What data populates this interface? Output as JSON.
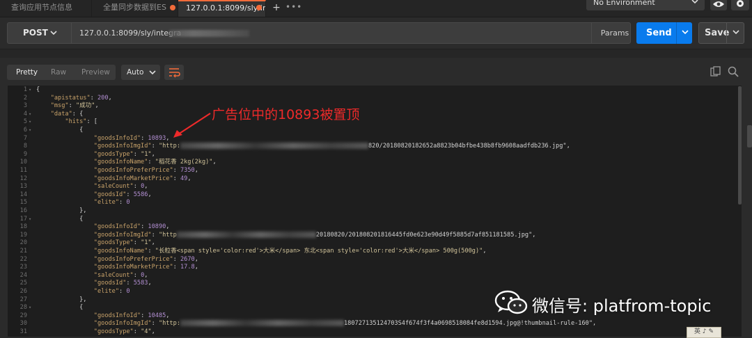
{
  "tabs": [
    {
      "label": "查询应用节点信息",
      "active": false,
      "unsaved": false
    },
    {
      "label": "全量同步数据到ES",
      "active": false,
      "unsaved": true
    },
    {
      "label": "127.0.0.1:8099/sly/in",
      "active": true,
      "unsaved": true
    }
  ],
  "tab_actions": {
    "add": "+",
    "more": "•••"
  },
  "environment": {
    "label": "No Environment"
  },
  "request": {
    "method": "POST",
    "url": "127.0.0.1:8099/sly/integra",
    "params_label": "Params",
    "send_label": "Send",
    "save_label": "Save"
  },
  "response_toolbar": {
    "formats": [
      "Pretty",
      "Raw",
      "Preview"
    ],
    "selected_format": "Pretty",
    "language": "Auto"
  },
  "colors": {
    "accent": "#f26b3a",
    "send": "#097bed",
    "annotation": "#ee2a2a"
  },
  "code_lines": [
    {
      "n": "1",
      "f": "▾",
      "t": "{"
    },
    {
      "n": "2",
      "f": "",
      "t": "    \"apistatus\": 200,"
    },
    {
      "n": "3",
      "f": "",
      "t": "    \"msg\": \"成功\","
    },
    {
      "n": "4",
      "f": "▾",
      "t": "    \"data\": {"
    },
    {
      "n": "5",
      "f": "▾",
      "t": "        \"hits\": ["
    },
    {
      "n": "6",
      "f": "▾",
      "t": "            {"
    },
    {
      "n": "7",
      "f": "",
      "t": "                \"goodsInfoId\": 10893,"
    },
    {
      "n": "8",
      "f": "",
      "t": "                \"goodsInfoImgId\": \"http:",
      "tail": "820/20180820182652a8823b04bfbe438b8fb9608aadfdb236.jpg\",",
      "blur": 270
    },
    {
      "n": "9",
      "f": "",
      "t": "                \"goodsType\": \"1\","
    },
    {
      "n": "10",
      "f": "",
      "t": "                \"goodsInfoName\": \"稻花香 2kg(2kg)\","
    },
    {
      "n": "11",
      "f": "",
      "t": "                \"goodsInfoPreferPrice\": 7350,"
    },
    {
      "n": "12",
      "f": "",
      "t": "                \"goodsInfoMarketPrice\": 49,"
    },
    {
      "n": "13",
      "f": "",
      "t": "                \"saleCount\": 0,"
    },
    {
      "n": "14",
      "f": "",
      "t": "                \"goodsId\": 5586,"
    },
    {
      "n": "15",
      "f": "",
      "t": "                \"elite\": 0"
    },
    {
      "n": "16",
      "f": "",
      "t": "            },"
    },
    {
      "n": "17",
      "f": "▾",
      "t": "            {"
    },
    {
      "n": "18",
      "f": "",
      "t": "                \"goodsInfoId\": 10890,"
    },
    {
      "n": "19",
      "f": "",
      "t": "                \"goodsInfoImgId\": \"http",
      "tail": "20180820/201808201816445fd0e623e90d49f5885d7af851181585.jpg\",",
      "blur": 200
    },
    {
      "n": "20",
      "f": "",
      "t": "                \"goodsType\": \"1\","
    },
    {
      "n": "21",
      "f": "",
      "t": "                \"goodsInfoName\": \"长粒香<span style='color:red'>大米</span> 东北<span style='color:red'>大米</span> 500g(500g)\","
    },
    {
      "n": "22",
      "f": "",
      "t": "                \"goodsInfoPreferPrice\": 2670,"
    },
    {
      "n": "23",
      "f": "",
      "t": "                \"goodsInfoMarketPrice\": 17.8,"
    },
    {
      "n": "24",
      "f": "",
      "t": "                \"saleCount\": 0,"
    },
    {
      "n": "25",
      "f": "",
      "t": "                \"goodsId\": 5583,"
    },
    {
      "n": "26",
      "f": "",
      "t": "                \"elite\": 0"
    },
    {
      "n": "27",
      "f": "",
      "t": "            },"
    },
    {
      "n": "28",
      "f": "▾",
      "t": "            {"
    },
    {
      "n": "29",
      "f": "",
      "t": "                \"goodsInfoId\": 10485,"
    },
    {
      "n": "30",
      "f": "",
      "t": "                \"goodsInfoImgId\": \"http:",
      "tail": "180727135124703S4f674f3f4a0698518084fe8d1594.jpg@!thumbnail-rule-160\",",
      "blur": 235
    },
    {
      "n": "31",
      "f": "",
      "t": "                \"goodsType\": \"4\","
    }
  ],
  "annotation": "广告位中的10893被置顶",
  "watermark": "微信号: platfrom-topic"
}
